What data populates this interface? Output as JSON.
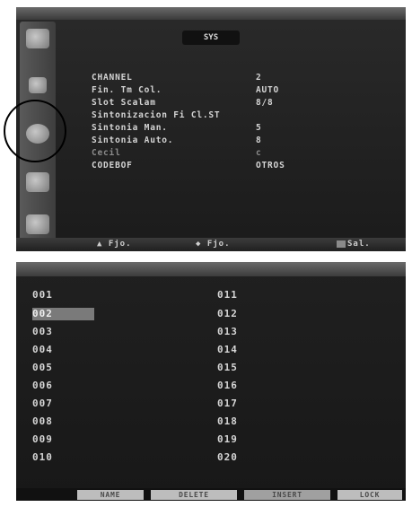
{
  "top_menu": {
    "title": "SYS",
    "rows": [
      {
        "label": "CHANNEL",
        "value": "2"
      },
      {
        "label": "Fin. Tm Col.",
        "value": "AUTO"
      },
      {
        "label": "Slot Scalam",
        "value": "8/8"
      },
      {
        "label": "Sintonizacion Fi Cl.ST",
        "value": ""
      },
      {
        "label": "Sintonia Man.",
        "value": "5"
      },
      {
        "label": "Sintonia Auto.",
        "value": "8"
      },
      {
        "label": "Cecil",
        "value": "c"
      },
      {
        "label": "CODEBOF",
        "value": "OTROS"
      }
    ],
    "footer": {
      "left": "▲ Fjo.",
      "middle": "◆ Fjo.",
      "right": "Sal."
    }
  },
  "channel_list": {
    "column1": [
      "001",
      "002",
      "003",
      "004",
      "005",
      "006",
      "007",
      "008",
      "009",
      "010"
    ],
    "column2": [
      "011",
      "012",
      "013",
      "014",
      "015",
      "016",
      "017",
      "018",
      "019",
      "020"
    ],
    "selected_index": 1
  },
  "bottom_footer": {
    "keys": [
      "NAME",
      "DELETE",
      "INSERT",
      "LOCK"
    ]
  }
}
